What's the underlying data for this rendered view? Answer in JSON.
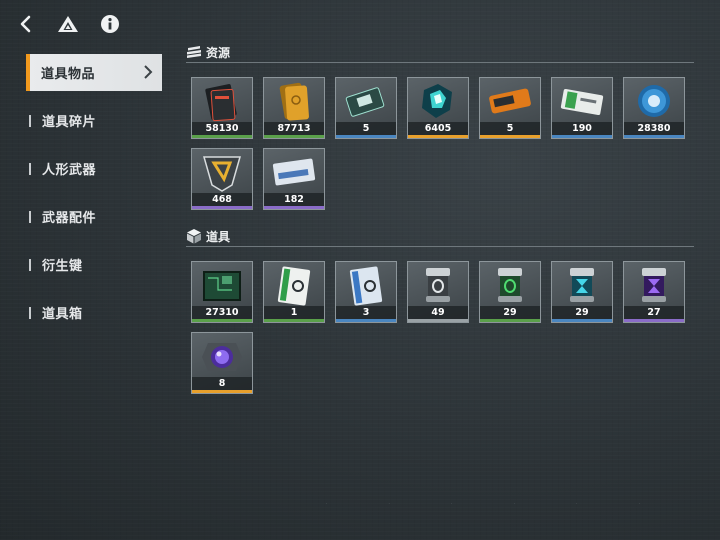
{
  "header": {
    "back_icon": "back-arrow-icon",
    "logo_icon": "triangle-logo-icon",
    "info_icon": "info-icon"
  },
  "sidebar": {
    "items": [
      {
        "label": "道具物品",
        "active": true
      },
      {
        "label": "道具碎片"
      },
      {
        "label": "人形武器"
      },
      {
        "label": "武器配件"
      },
      {
        "label": "衍生键"
      },
      {
        "label": "道具箱"
      }
    ]
  },
  "sections": {
    "resources": {
      "title": "资源",
      "items": [
        {
          "name": "black-card-ticket",
          "count": "58130",
          "rarity": "#5aa04a"
        },
        {
          "name": "gold-bar",
          "count": "87713",
          "rarity": "#5aa04a"
        },
        {
          "name": "data-chip-card",
          "count": "5",
          "rarity": "#4a86c0"
        },
        {
          "name": "crystal-core",
          "count": "6405",
          "rarity": "#e8a02c"
        },
        {
          "name": "orange-access-card",
          "count": "5",
          "rarity": "#e8a02c"
        },
        {
          "name": "green-ticket",
          "count": "190",
          "rarity": "#4a86c0"
        },
        {
          "name": "blue-token-coin",
          "count": "28380",
          "rarity": "#4a86c0"
        },
        {
          "name": "gold-emblem-badge",
          "count": "468",
          "rarity": "#8a6cc8"
        },
        {
          "name": "blue-pass-card",
          "count": "182",
          "rarity": "#8a6cc8"
        }
      ]
    },
    "props": {
      "title": "道具",
      "items": [
        {
          "name": "circuit-board",
          "count": "27310",
          "rarity": "#5aa04a"
        },
        {
          "name": "green-key-card",
          "count": "1",
          "rarity": "#5aa04a"
        },
        {
          "name": "blue-key-card",
          "count": "3",
          "rarity": "#4a86c0"
        },
        {
          "name": "gray-canister",
          "count": "49",
          "rarity": "#9aa2a6"
        },
        {
          "name": "green-canister",
          "count": "29",
          "rarity": "#5aa04a"
        },
        {
          "name": "cyan-canister",
          "count": "29",
          "rarity": "#4a86c0"
        },
        {
          "name": "purple-canister",
          "count": "27",
          "rarity": "#8a6cc8"
        },
        {
          "name": "purple-orb-device",
          "count": "8",
          "rarity": "#e8a02c"
        }
      ]
    }
  }
}
